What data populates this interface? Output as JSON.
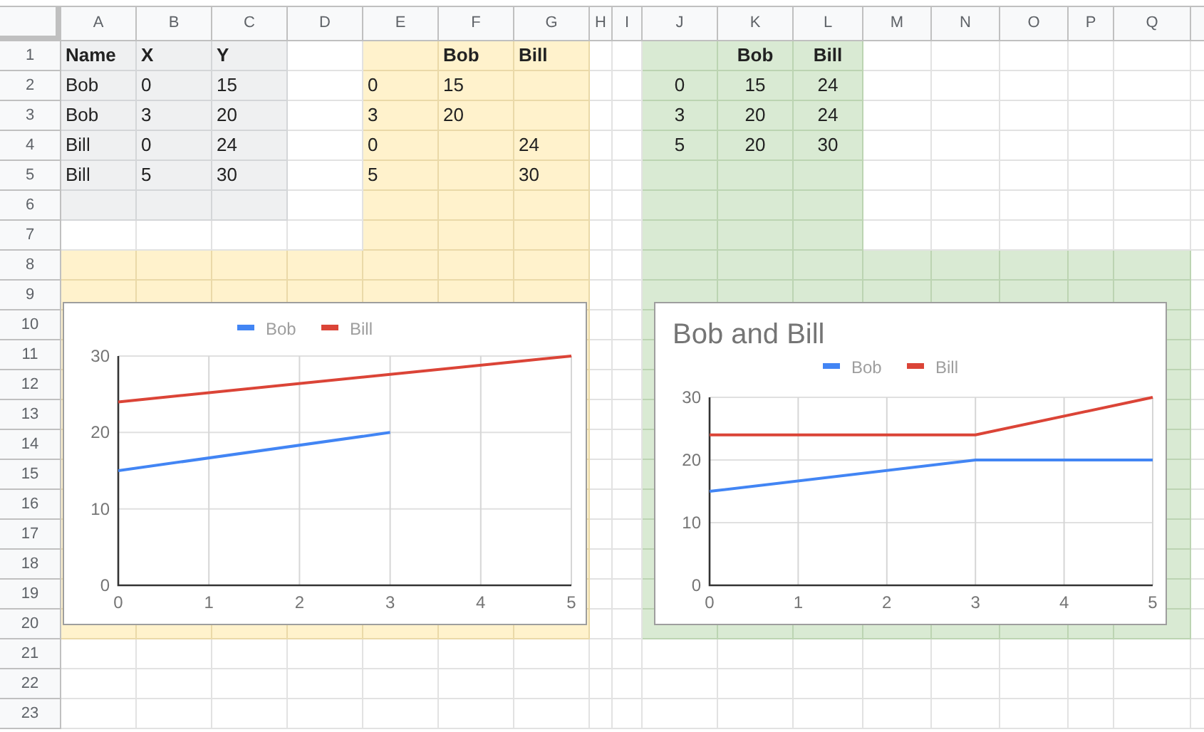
{
  "sheet": {
    "columns": [
      "A",
      "B",
      "C",
      "D",
      "E",
      "F",
      "G",
      "H",
      "I",
      "J",
      "K",
      "L",
      "M",
      "N",
      "O",
      "P",
      "Q"
    ],
    "rows": [
      {
        "label": "1",
        "cells": {
          "A": {
            "text": "Name",
            "bold": true
          },
          "B": {
            "text": "X",
            "bold": true
          },
          "C": {
            "text": "Y",
            "bold": true
          },
          "F": {
            "text": "Bob",
            "bold": true
          },
          "G": {
            "text": "Bill",
            "bold": true
          },
          "K": {
            "text": "Bob",
            "bold": true
          },
          "L": {
            "text": "Bill",
            "bold": true
          }
        }
      },
      {
        "label": "2",
        "cells": {
          "A": {
            "text": "Bob",
            "bold": false
          },
          "B": {
            "text": "0",
            "bold": false
          },
          "C": {
            "text": "15",
            "bold": false
          },
          "E": {
            "text": "0",
            "bold": false
          },
          "F": {
            "text": "15",
            "bold": false
          },
          "J": {
            "text": "0",
            "bold": false
          },
          "K": {
            "text": "15",
            "bold": false
          },
          "L": {
            "text": "24",
            "bold": false
          }
        }
      },
      {
        "label": "3",
        "cells": {
          "A": {
            "text": "Bob",
            "bold": false
          },
          "B": {
            "text": "3",
            "bold": false
          },
          "C": {
            "text": "20",
            "bold": false
          },
          "E": {
            "text": "3",
            "bold": false
          },
          "F": {
            "text": "20",
            "bold": false
          },
          "J": {
            "text": "3",
            "bold": false
          },
          "K": {
            "text": "20",
            "bold": false
          },
          "L": {
            "text": "24",
            "bold": false
          }
        }
      },
      {
        "label": "4",
        "cells": {
          "A": {
            "text": "Bill",
            "bold": false
          },
          "B": {
            "text": "0",
            "bold": false
          },
          "C": {
            "text": "24",
            "bold": false
          },
          "E": {
            "text": "0",
            "bold": false
          },
          "G": {
            "text": "24",
            "bold": false
          },
          "J": {
            "text": "5",
            "bold": false
          },
          "K": {
            "text": "20",
            "bold": false
          },
          "L": {
            "text": "30",
            "bold": false
          }
        }
      },
      {
        "label": "5",
        "cells": {
          "A": {
            "text": "Bill",
            "bold": false
          },
          "B": {
            "text": "5",
            "bold": false
          },
          "C": {
            "text": "30",
            "bold": false
          },
          "E": {
            "text": "5",
            "bold": false
          },
          "G": {
            "text": "30",
            "bold": false
          }
        }
      },
      {
        "label": "6",
        "cells": {}
      },
      {
        "label": "7",
        "cells": {}
      },
      {
        "label": "8",
        "cells": {}
      },
      {
        "label": "9",
        "cells": {}
      },
      {
        "label": "10",
        "cells": {}
      },
      {
        "label": "11",
        "cells": {}
      },
      {
        "label": "12",
        "cells": {}
      },
      {
        "label": "13",
        "cells": {}
      },
      {
        "label": "14",
        "cells": {}
      },
      {
        "label": "15",
        "cells": {}
      },
      {
        "label": "16",
        "cells": {}
      },
      {
        "label": "17",
        "cells": {}
      },
      {
        "label": "18",
        "cells": {}
      },
      {
        "label": "19",
        "cells": {}
      },
      {
        "label": "20",
        "cells": {}
      },
      {
        "label": "21",
        "cells": {}
      },
      {
        "label": "22",
        "cells": {}
      },
      {
        "label": "23",
        "cells": {}
      }
    ]
  },
  "charts": [
    {
      "chart_data": {
        "type": "line",
        "grid": true,
        "legend": true,
        "x": [
          0,
          3,
          5
        ],
        "xlim": [
          0,
          5
        ],
        "ylim": [
          0,
          30
        ],
        "xticks": [
          {
            "value": 0,
            "label": "0"
          },
          {
            "value": 1,
            "label": "1"
          },
          {
            "value": 2,
            "label": "2"
          },
          {
            "value": 3,
            "label": "3"
          },
          {
            "value": 4,
            "label": "4"
          },
          {
            "value": 5,
            "label": "5"
          }
        ],
        "yticks": [
          {
            "value": 0,
            "label": "0"
          },
          {
            "value": 10,
            "label": "10"
          },
          {
            "value": 20,
            "label": "20"
          },
          {
            "value": 30,
            "label": "30"
          }
        ],
        "series": [
          {
            "name": "Bob",
            "color": "#4285f4",
            "values": [
              15,
              20,
              null
            ]
          },
          {
            "name": "Bill",
            "color": "#db4437",
            "values": [
              24,
              null,
              30
            ]
          }
        ]
      }
    },
    {
      "chart_data": {
        "type": "line",
        "grid": true,
        "legend": true,
        "title": "Bob and Bill",
        "x": [
          0,
          3,
          5
        ],
        "xlim": [
          0,
          5
        ],
        "ylim": [
          0,
          30
        ],
        "xticks": [
          {
            "value": 0,
            "label": "0"
          },
          {
            "value": 1,
            "label": "1"
          },
          {
            "value": 2,
            "label": "2"
          },
          {
            "value": 3,
            "label": "3"
          },
          {
            "value": 4,
            "label": "4"
          },
          {
            "value": 5,
            "label": "5"
          }
        ],
        "yticks": [
          {
            "value": 0,
            "label": "0"
          },
          {
            "value": 10,
            "label": "10"
          },
          {
            "value": 20,
            "label": "20"
          },
          {
            "value": 30,
            "label": "30"
          }
        ],
        "series": [
          {
            "name": "Bob",
            "color": "#4285f4",
            "values": [
              15,
              20,
              20
            ]
          },
          {
            "name": "Bill",
            "color": "#db4437",
            "values": [
              24,
              24,
              30
            ]
          }
        ]
      }
    }
  ]
}
